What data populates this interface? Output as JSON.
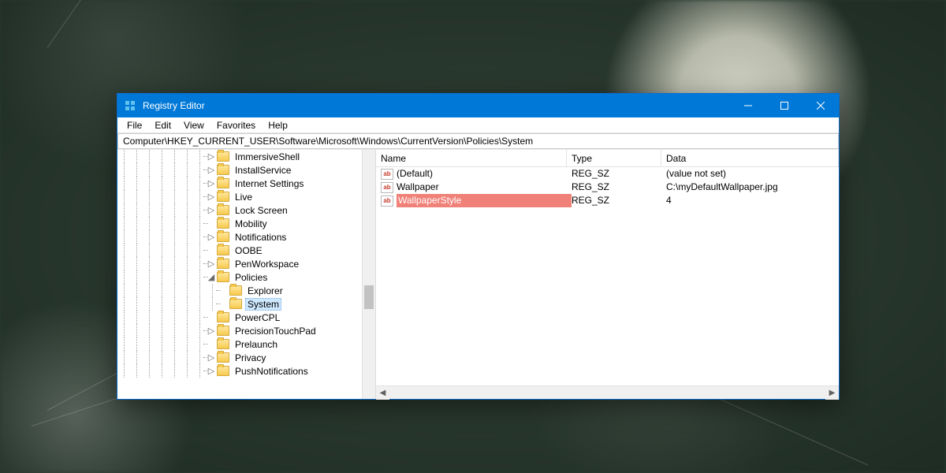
{
  "window": {
    "title": "Registry Editor"
  },
  "menu": {
    "file": "File",
    "edit": "Edit",
    "view": "View",
    "favorites": "Favorites",
    "help": "Help"
  },
  "address": "Computer\\HKEY_CURRENT_USER\\Software\\Microsoft\\Windows\\CurrentVersion\\Policies\\System",
  "tree": [
    {
      "label": "ImmersiveShell",
      "exp": ">"
    },
    {
      "label": "InstallService",
      "exp": ">"
    },
    {
      "label": "Internet Settings",
      "exp": ">"
    },
    {
      "label": "Live",
      "exp": ">"
    },
    {
      "label": "Lock Screen",
      "exp": ">"
    },
    {
      "label": "Mobility",
      "exp": ""
    },
    {
      "label": "Notifications",
      "exp": ">"
    },
    {
      "label": "OOBE",
      "exp": ""
    },
    {
      "label": "PenWorkspace",
      "exp": ">"
    },
    {
      "label": "Policies",
      "exp": "v",
      "children": [
        {
          "label": "Explorer"
        },
        {
          "label": "System",
          "selected": true
        }
      ]
    },
    {
      "label": "PowerCPL",
      "exp": ""
    },
    {
      "label": "PrecisionTouchPad",
      "exp": ">"
    },
    {
      "label": "Prelaunch",
      "exp": ""
    },
    {
      "label": "Privacy",
      "exp": ">"
    },
    {
      "label": "PushNotifications",
      "exp": ">",
      "cut": true
    }
  ],
  "columns": {
    "name": "Name",
    "type": "Type",
    "data": "Data"
  },
  "values": [
    {
      "name": "(Default)",
      "type": "REG_SZ",
      "data": "(value not set)"
    },
    {
      "name": "Wallpaper",
      "type": "REG_SZ",
      "data": "C:\\myDefaultWallpaper.jpg"
    },
    {
      "name": "WallpaperStyle",
      "type": "REG_SZ",
      "data": "4",
      "highlight": true
    }
  ]
}
